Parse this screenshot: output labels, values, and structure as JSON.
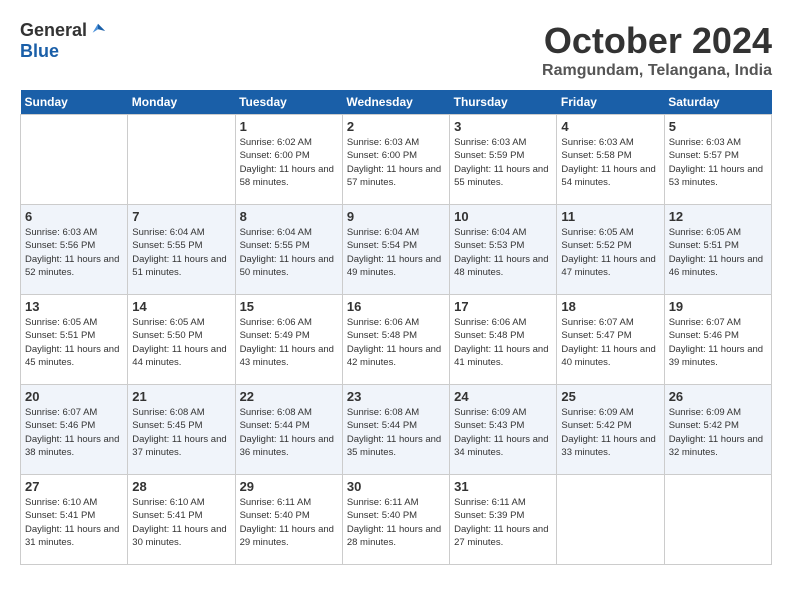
{
  "header": {
    "logo_general": "General",
    "logo_blue": "Blue",
    "month_title": "October 2024",
    "location": "Ramgundam, Telangana, India"
  },
  "calendar": {
    "days_of_week": [
      "Sunday",
      "Monday",
      "Tuesday",
      "Wednesday",
      "Thursday",
      "Friday",
      "Saturday"
    ],
    "weeks": [
      [
        {
          "day": "",
          "info": ""
        },
        {
          "day": "",
          "info": ""
        },
        {
          "day": "1",
          "info": "Sunrise: 6:02 AM\nSunset: 6:00 PM\nDaylight: 11 hours and 58 minutes."
        },
        {
          "day": "2",
          "info": "Sunrise: 6:03 AM\nSunset: 6:00 PM\nDaylight: 11 hours and 57 minutes."
        },
        {
          "day": "3",
          "info": "Sunrise: 6:03 AM\nSunset: 5:59 PM\nDaylight: 11 hours and 55 minutes."
        },
        {
          "day": "4",
          "info": "Sunrise: 6:03 AM\nSunset: 5:58 PM\nDaylight: 11 hours and 54 minutes."
        },
        {
          "day": "5",
          "info": "Sunrise: 6:03 AM\nSunset: 5:57 PM\nDaylight: 11 hours and 53 minutes."
        }
      ],
      [
        {
          "day": "6",
          "info": "Sunrise: 6:03 AM\nSunset: 5:56 PM\nDaylight: 11 hours and 52 minutes."
        },
        {
          "day": "7",
          "info": "Sunrise: 6:04 AM\nSunset: 5:55 PM\nDaylight: 11 hours and 51 minutes."
        },
        {
          "day": "8",
          "info": "Sunrise: 6:04 AM\nSunset: 5:55 PM\nDaylight: 11 hours and 50 minutes."
        },
        {
          "day": "9",
          "info": "Sunrise: 6:04 AM\nSunset: 5:54 PM\nDaylight: 11 hours and 49 minutes."
        },
        {
          "day": "10",
          "info": "Sunrise: 6:04 AM\nSunset: 5:53 PM\nDaylight: 11 hours and 48 minutes."
        },
        {
          "day": "11",
          "info": "Sunrise: 6:05 AM\nSunset: 5:52 PM\nDaylight: 11 hours and 47 minutes."
        },
        {
          "day": "12",
          "info": "Sunrise: 6:05 AM\nSunset: 5:51 PM\nDaylight: 11 hours and 46 minutes."
        }
      ],
      [
        {
          "day": "13",
          "info": "Sunrise: 6:05 AM\nSunset: 5:51 PM\nDaylight: 11 hours and 45 minutes."
        },
        {
          "day": "14",
          "info": "Sunrise: 6:05 AM\nSunset: 5:50 PM\nDaylight: 11 hours and 44 minutes."
        },
        {
          "day": "15",
          "info": "Sunrise: 6:06 AM\nSunset: 5:49 PM\nDaylight: 11 hours and 43 minutes."
        },
        {
          "day": "16",
          "info": "Sunrise: 6:06 AM\nSunset: 5:48 PM\nDaylight: 11 hours and 42 minutes."
        },
        {
          "day": "17",
          "info": "Sunrise: 6:06 AM\nSunset: 5:48 PM\nDaylight: 11 hours and 41 minutes."
        },
        {
          "day": "18",
          "info": "Sunrise: 6:07 AM\nSunset: 5:47 PM\nDaylight: 11 hours and 40 minutes."
        },
        {
          "day": "19",
          "info": "Sunrise: 6:07 AM\nSunset: 5:46 PM\nDaylight: 11 hours and 39 minutes."
        }
      ],
      [
        {
          "day": "20",
          "info": "Sunrise: 6:07 AM\nSunset: 5:46 PM\nDaylight: 11 hours and 38 minutes."
        },
        {
          "day": "21",
          "info": "Sunrise: 6:08 AM\nSunset: 5:45 PM\nDaylight: 11 hours and 37 minutes."
        },
        {
          "day": "22",
          "info": "Sunrise: 6:08 AM\nSunset: 5:44 PM\nDaylight: 11 hours and 36 minutes."
        },
        {
          "day": "23",
          "info": "Sunrise: 6:08 AM\nSunset: 5:44 PM\nDaylight: 11 hours and 35 minutes."
        },
        {
          "day": "24",
          "info": "Sunrise: 6:09 AM\nSunset: 5:43 PM\nDaylight: 11 hours and 34 minutes."
        },
        {
          "day": "25",
          "info": "Sunrise: 6:09 AM\nSunset: 5:42 PM\nDaylight: 11 hours and 33 minutes."
        },
        {
          "day": "26",
          "info": "Sunrise: 6:09 AM\nSunset: 5:42 PM\nDaylight: 11 hours and 32 minutes."
        }
      ],
      [
        {
          "day": "27",
          "info": "Sunrise: 6:10 AM\nSunset: 5:41 PM\nDaylight: 11 hours and 31 minutes."
        },
        {
          "day": "28",
          "info": "Sunrise: 6:10 AM\nSunset: 5:41 PM\nDaylight: 11 hours and 30 minutes."
        },
        {
          "day": "29",
          "info": "Sunrise: 6:11 AM\nSunset: 5:40 PM\nDaylight: 11 hours and 29 minutes."
        },
        {
          "day": "30",
          "info": "Sunrise: 6:11 AM\nSunset: 5:40 PM\nDaylight: 11 hours and 28 minutes."
        },
        {
          "day": "31",
          "info": "Sunrise: 6:11 AM\nSunset: 5:39 PM\nDaylight: 11 hours and 27 minutes."
        },
        {
          "day": "",
          "info": ""
        },
        {
          "day": "",
          "info": ""
        }
      ]
    ]
  }
}
